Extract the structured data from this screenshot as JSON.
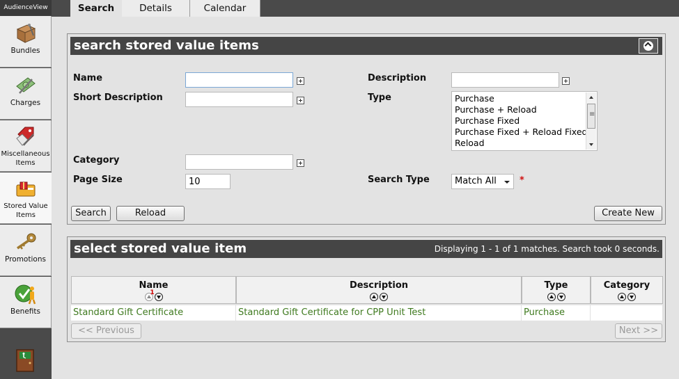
{
  "brand": "AudienceView",
  "sidebar": {
    "items": [
      {
        "label": "Bundles",
        "icon": "box-icon"
      },
      {
        "label": "Charges",
        "icon": "money-icon"
      },
      {
        "label": "Miscellaneous Items",
        "icon": "tag-icon"
      },
      {
        "label": "Stored Value Items",
        "icon": "gift-card-icon"
      },
      {
        "label": "Promotions",
        "icon": "key-icon"
      },
      {
        "label": "Benefits",
        "icon": "checkmark-person-icon"
      }
    ]
  },
  "tabs": [
    "Search",
    "Details",
    "Calendar"
  ],
  "search_panel": {
    "title": "search stored value items",
    "fields": {
      "name": {
        "label": "Name",
        "value": ""
      },
      "short_description": {
        "label": "Short Description",
        "value": ""
      },
      "category": {
        "label": "Category",
        "value": ""
      },
      "page_size": {
        "label": "Page Size",
        "value": "10"
      },
      "description": {
        "label": "Description",
        "value": ""
      },
      "type": {
        "label": "Type",
        "options": [
          "Purchase",
          "Purchase + Reload",
          "Purchase Fixed",
          "Purchase Fixed + Reload Fixed",
          "Reload"
        ]
      },
      "search_type": {
        "label": "Search Type",
        "value": "Match All",
        "required_mark": "*"
      }
    },
    "buttons": {
      "search": "Search",
      "reload": "Reload",
      "create_new": "Create New"
    }
  },
  "results_panel": {
    "title": "select stored value item",
    "status": "Displaying 1 - 1 of 1 matches. Search took 0 seconds.",
    "columns": [
      "Name",
      "Description",
      "Type",
      "Category"
    ],
    "sort_index": "1",
    "rows": [
      {
        "name": "Standard Gift Certificate",
        "description": "Standard Gift Certificate for CPP Unit Test",
        "type": "Purchase",
        "category": ""
      }
    ],
    "pager": {
      "previous": "<< Previous",
      "next": "Next >>"
    }
  },
  "colors": {
    "header": "#454545",
    "link": "#3f7a1f",
    "background": "#e3e3e3"
  }
}
